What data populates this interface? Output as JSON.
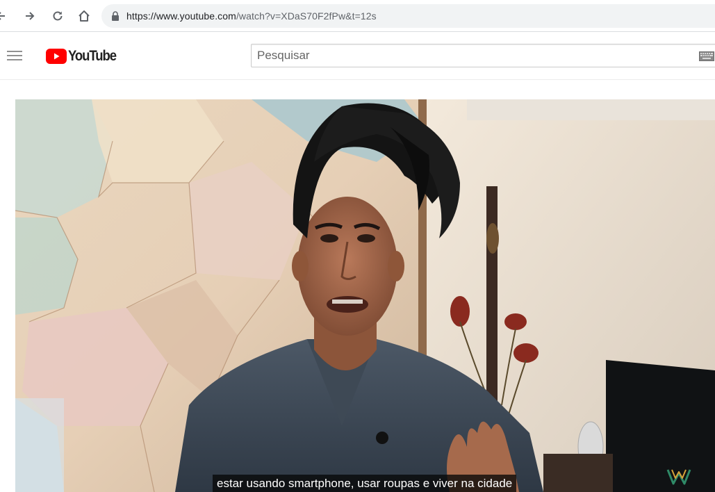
{
  "browser": {
    "url_host": "https://www.youtube.com",
    "url_path": "/watch?v=XDaS70F2fPw&t=12s"
  },
  "masthead": {
    "logo_text": "YouTube",
    "search_placeholder": "Pesquisar"
  },
  "player": {
    "caption": "estar usando smartphone, usar roupas e viver na cidade"
  },
  "colors": {
    "yt_red": "#ff0000",
    "icon_gray": "#5f6368",
    "caption_bg": "#080808"
  },
  "icons": [
    "back-arrow-icon",
    "forward-arrow-icon",
    "reload-icon",
    "home-icon",
    "lock-icon",
    "hamburger-menu-icon",
    "youtube-play-icon",
    "keyboard-icon",
    "channel-watermark-icon"
  ]
}
